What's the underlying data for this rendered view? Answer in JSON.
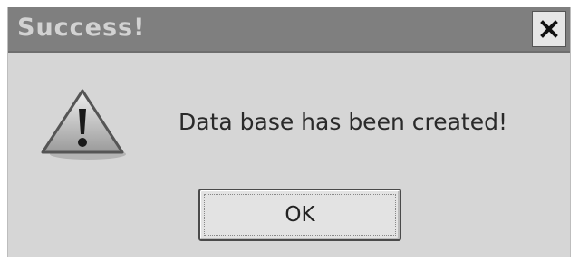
{
  "dialog": {
    "title": "Success!",
    "message": "Data base has been created!",
    "ok_label": "OK",
    "close_icon": "close-icon",
    "warning_icon": "warning-icon"
  },
  "colors": {
    "titlebar": "#7f7f7f",
    "title_text": "#d2d2d2",
    "body": "#d6d6d6",
    "button_face": "#e3e3e3"
  }
}
